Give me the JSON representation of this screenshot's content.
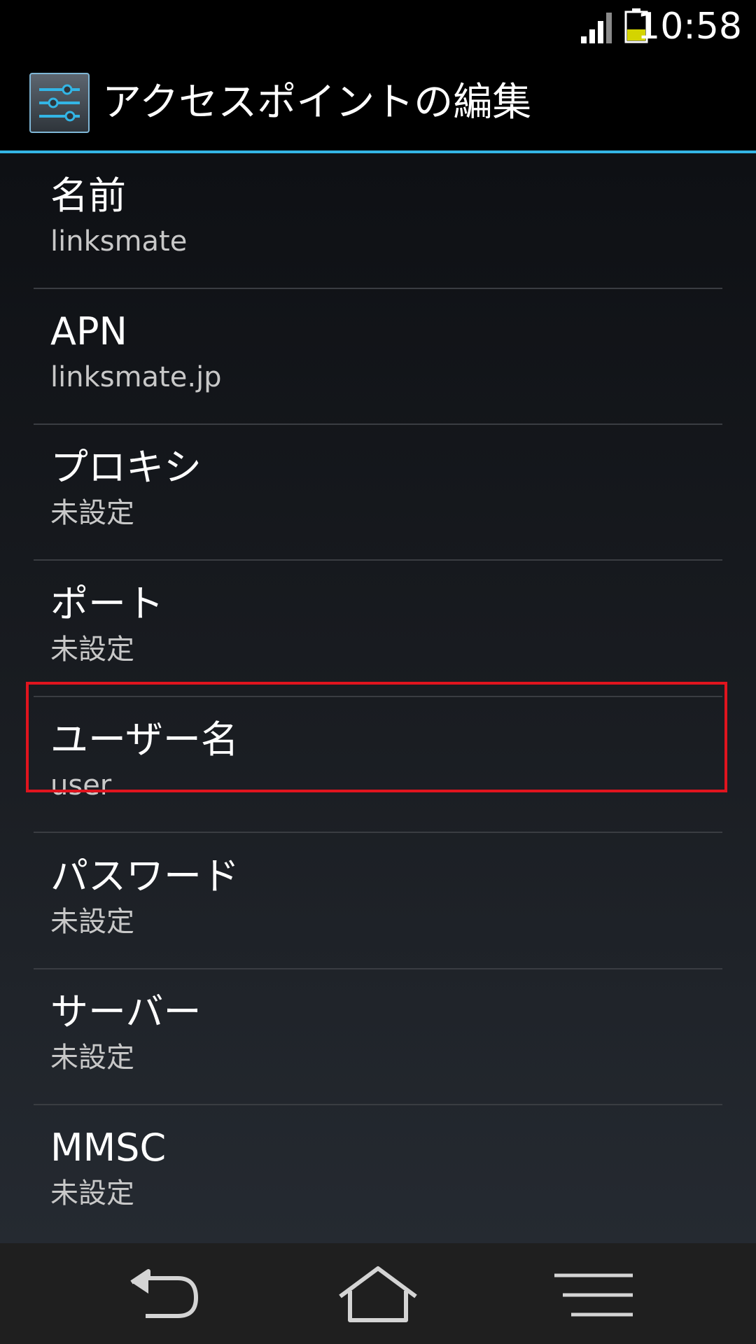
{
  "status_bar": {
    "time": "10:58",
    "signal_icon": "cell-signal-icon",
    "battery_icon": "battery-icon",
    "battery_color": "#d4d400"
  },
  "action_bar": {
    "title": "アクセスポイントの編集",
    "app_icon": "settings-sliders-icon",
    "accent_color": "#33b5e5"
  },
  "preferences": [
    {
      "title": "名前",
      "summary": "linksmate"
    },
    {
      "title": "APN",
      "summary": "linksmate.jp"
    },
    {
      "title": "プロキシ",
      "summary": "未設定"
    },
    {
      "title": "ポート",
      "summary": "未設定"
    },
    {
      "title": "ユーザー名",
      "summary": "user"
    },
    {
      "title": "パスワード",
      "summary": "未設定"
    },
    {
      "title": "サーバー",
      "summary": "未設定"
    },
    {
      "title": "MMSC",
      "summary": "未設定"
    }
  ],
  "highlight_color": "#e0141e",
  "nav_bar": {
    "back_icon": "back-icon",
    "home_icon": "home-icon",
    "menu_icon": "menu-icon"
  }
}
